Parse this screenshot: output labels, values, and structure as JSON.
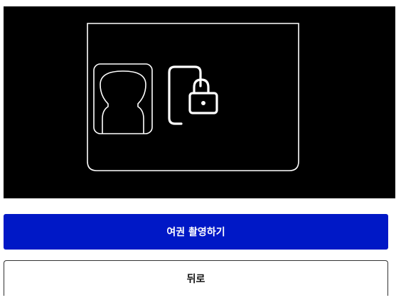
{
  "capture": {
    "illustration_icons": [
      "passport-frame-icon",
      "face-silhouette-icon",
      "phone-lock-icon"
    ]
  },
  "actions": {
    "primary_label": "여권 촬영하기",
    "secondary_label": "뒤로"
  },
  "colors": {
    "camera_background": "#000000",
    "illustration_stroke": "#ffffff",
    "primary_button": "#0018c6",
    "primary_text": "#ffffff",
    "secondary_border": "#333333"
  }
}
